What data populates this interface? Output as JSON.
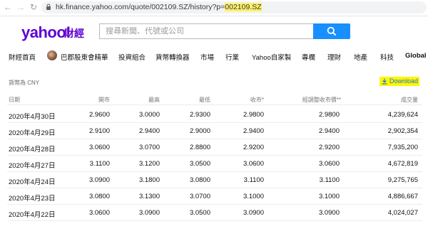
{
  "browser": {
    "url_prefix": "hk.finance.yahoo.com/quote/002109.SZ/history?p=",
    "url_highlight": "002109.SZ"
  },
  "header": {
    "logo_text": "yahoo!",
    "logo_sub": "財經",
    "search_placeholder": "搜尋新聞、代號或公司"
  },
  "nav": [
    "財經首頁",
    "巴郡股東會精華",
    "投資組合",
    "貨幣轉換器",
    "市場",
    "行業",
    "Yahoo自家製",
    "專欄",
    "理財",
    "地產",
    "科技",
    "Global"
  ],
  "content": {
    "currency_note": "貨幣為 CNY",
    "download_label": "Download"
  },
  "table": {
    "headers": [
      "日期",
      "開市",
      "最高",
      "最低",
      "收市*",
      "經調整收市價**",
      "成交量"
    ],
    "rows": [
      [
        "2020年4月30日",
        "2.9600",
        "3.0000",
        "2.9300",
        "2.9800",
        "2.9800",
        "4,239,624"
      ],
      [
        "2020年4月29日",
        "2.9100",
        "2.9400",
        "2.9000",
        "2.9400",
        "2.9400",
        "2,902,354"
      ],
      [
        "2020年4月28日",
        "3.0600",
        "3.0700",
        "2.8800",
        "2.9200",
        "2.9200",
        "7,935,200"
      ],
      [
        "2020年4月27日",
        "3.1100",
        "3.1200",
        "3.0500",
        "3.0600",
        "3.0600",
        "4,672,819"
      ],
      [
        "2020年4月24日",
        "3.0900",
        "3.1800",
        "3.0800",
        "3.1100",
        "3.1100",
        "9,275,765"
      ],
      [
        "2020年4月23日",
        "3.0800",
        "3.1300",
        "3.0700",
        "3.1000",
        "3.1000",
        "4,886,667"
      ],
      [
        "2020年4月22日",
        "3.0600",
        "3.0900",
        "3.0500",
        "3.0900",
        "3.0900",
        "4,024,027"
      ]
    ]
  },
  "colors": {
    "brand_purple": "#5f01d1",
    "search_blue": "#188fff",
    "highlight_yellow": "#fff700"
  }
}
